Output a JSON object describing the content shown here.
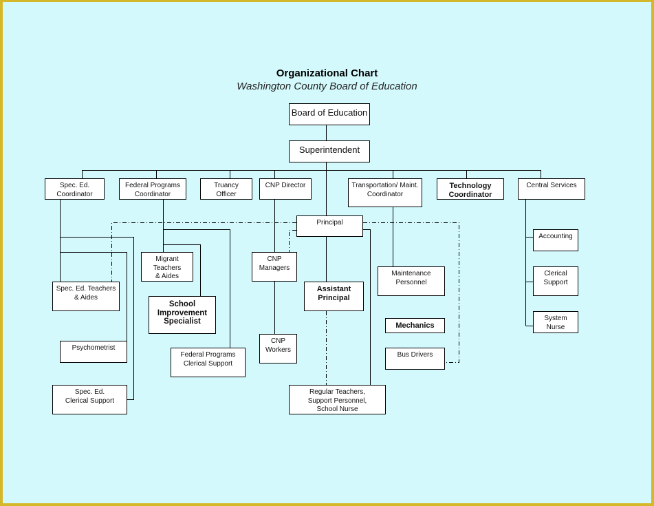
{
  "colors": {
    "background": "#d4f9fc",
    "frame": "#d4b82a",
    "box": "#ffffff",
    "line": "#000000"
  },
  "header": {
    "title": "Organizational Chart",
    "subtitle": "Washington County Board of Education"
  },
  "nodes": {
    "board": "Board of Education",
    "superintendent": "Superintendent",
    "sped_coord": "Spec. Ed.\nCoordinator",
    "fed_coord": "Federal Programs\nCoordinator",
    "truancy": "Truancy\nOfficer",
    "cnp_director": "CNP Director",
    "transport": "Transportation/ Maint.\nCoordinator",
    "technology": "Technology\nCoordinator",
    "central": "Central Services",
    "principal": "Principal",
    "sped_teachers": "Spec. Ed. Teachers\n& Aides",
    "psychometrist": "Psychometrist",
    "sped_clerical": "Spec. Ed.\nClerical Support",
    "migrant": "Migrant\nTeachers\n& Aides",
    "school_improvement": "School\nImprovement\nSpecialist",
    "fed_clerical": "Federal Programs\nClerical Support",
    "cnp_managers": "CNP\nManagers",
    "cnp_workers": "CNP\nWorkers",
    "assistant_principal": "Assistant\nPrincipal",
    "regular_teachers": "Regular Teachers,\nSupport Personnel,\nSchool Nurse",
    "maintenance": "Maintenance\nPersonnel",
    "mechanics": "Mechanics",
    "bus_drivers": "Bus Drivers",
    "accounting": "Accounting",
    "clerical_support": "Clerical\nSupport",
    "system_nurse": "System\nNurse"
  }
}
